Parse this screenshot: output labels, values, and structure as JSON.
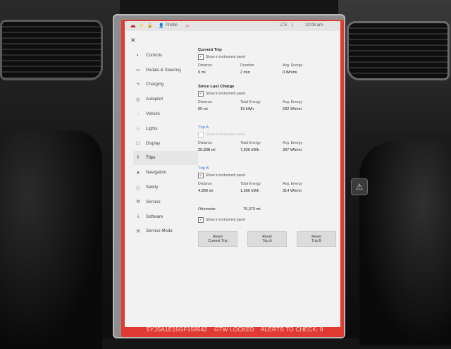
{
  "status_bar": {
    "profile_label": "Profile",
    "time": "10:08 am",
    "signal_text": "LTE"
  },
  "nav": {
    "items": [
      {
        "label": "Controls",
        "icon": "toggle-icon"
      },
      {
        "label": "Pedals & Steering",
        "icon": "car-icon"
      },
      {
        "label": "Charging",
        "icon": "lightning-icon"
      },
      {
        "label": "Autopilot",
        "icon": "steering-wheel-icon"
      },
      {
        "label": "Vehicle",
        "icon": "sliders-icon"
      },
      {
        "label": "Lights",
        "icon": "lightbulb-icon"
      },
      {
        "label": "Display",
        "icon": "display-icon"
      },
      {
        "label": "Trips",
        "icon": "trips-icon",
        "active": true
      },
      {
        "label": "Navigation",
        "icon": "navigation-icon"
      },
      {
        "label": "Safety",
        "icon": "safety-icon"
      },
      {
        "label": "Service",
        "icon": "wrench-icon"
      },
      {
        "label": "Software",
        "icon": "download-icon"
      },
      {
        "label": "Service Mode",
        "icon": "wrench-icon"
      }
    ]
  },
  "current_trip": {
    "title": "Current Trip",
    "checkbox_label": "Show in instrument panel",
    "stats": [
      {
        "label": "Distance",
        "value": "0 mi"
      },
      {
        "label": "Duration",
        "value": "2 min"
      },
      {
        "label": "Avg. Energy",
        "value": "0 Wh/mi"
      }
    ]
  },
  "since_last_charge": {
    "title": "Since Last Charge",
    "checkbox_label": "Show in instrument panel",
    "stats": [
      {
        "label": "Distance",
        "value": "65 mi"
      },
      {
        "label": "Total Energy",
        "value": "19 kWh"
      },
      {
        "label": "Avg. Energy",
        "value": "292 Wh/mi"
      }
    ]
  },
  "trip_a": {
    "title": "Trip A",
    "checkbox_label": "Show in instrument panel",
    "stats": [
      {
        "label": "Distance",
        "value": "25,838 mi"
      },
      {
        "label": "Total Energy",
        "value": "7,926 kWh"
      },
      {
        "label": "Avg. Energy",
        "value": "307 Wh/mi"
      }
    ]
  },
  "trip_b": {
    "title": "Trip B",
    "checkbox_label": "Show in instrument panel",
    "stats": [
      {
        "label": "Distance",
        "value": "4,989 mi"
      },
      {
        "label": "Total Energy",
        "value": "1,566 kWh"
      },
      {
        "label": "Avg. Energy",
        "value": "314 Wh/mi"
      }
    ]
  },
  "odometer": {
    "label": "Odometer",
    "value": "70,373 mi",
    "checkbox_label": "Show in instrument panel"
  },
  "buttons": {
    "reset_current": "Reset\nCurrent Trip",
    "reset_a": "Reset\nTrip A",
    "reset_b": "Reset\nTrip B"
  },
  "footer": {
    "vin": "5YJSA1E15GF159542",
    "gtw": "GTW LOCKED",
    "alerts": "ALERTS TO CHECK: 9"
  },
  "colors": {
    "screen_border": "#e03a32",
    "accent_blue": "#3a72c4"
  }
}
